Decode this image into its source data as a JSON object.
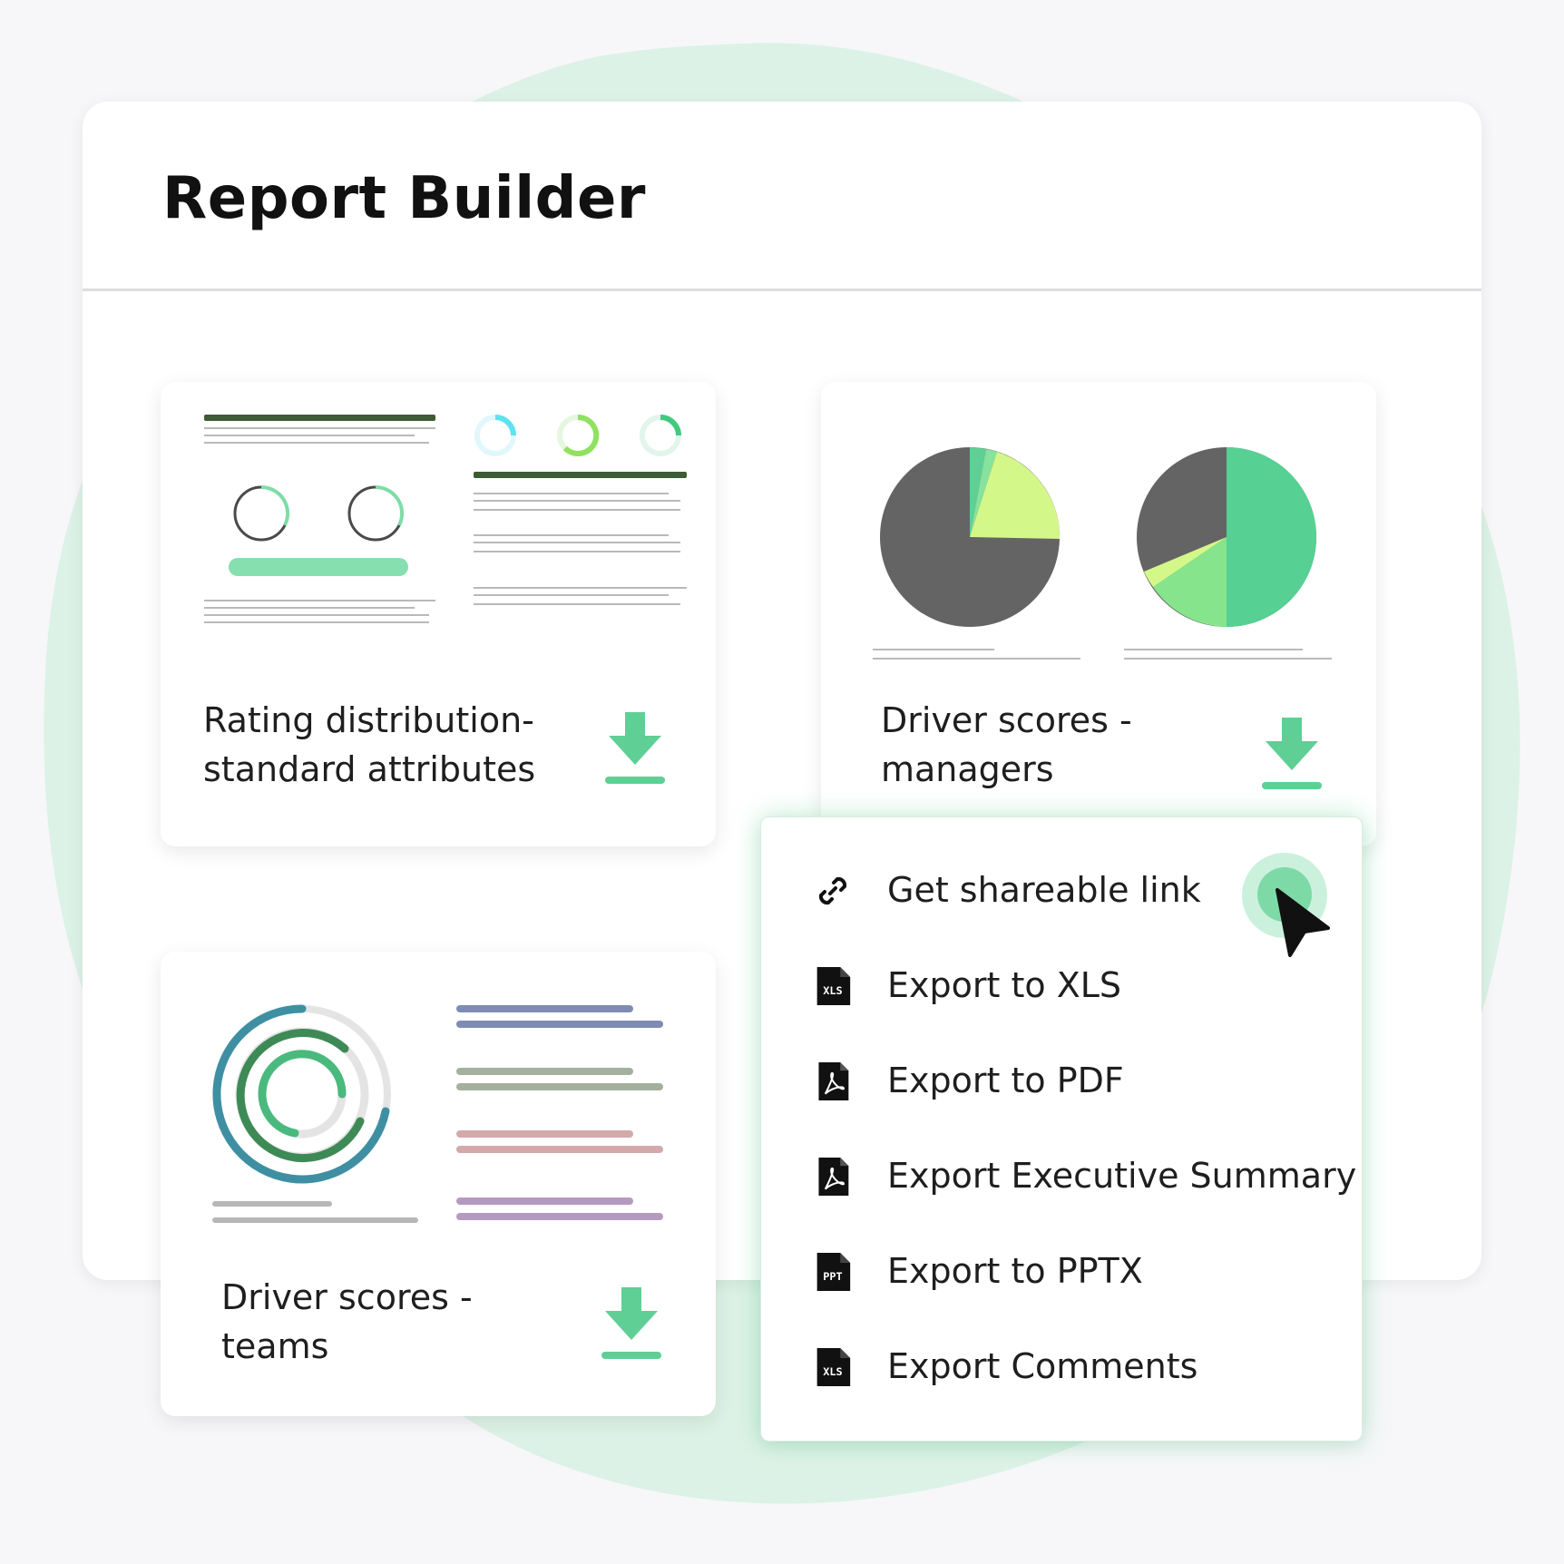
{
  "panel": {
    "title": "Report Builder"
  },
  "cards": [
    {
      "title": "Rating distribution-\nstandard attributes",
      "action_icon": "download-icon"
    },
    {
      "title": "Driver scores -\nmanagers",
      "action_icon": "download-icon"
    },
    {
      "title": "Driver scores -\nteams",
      "action_icon": "download-icon"
    }
  ],
  "export_menu": {
    "items": [
      {
        "label": "Get shareable link",
        "icon": "link-icon"
      },
      {
        "label": "Export to XLS",
        "icon": "xls-file-icon"
      },
      {
        "label": "Export to PDF",
        "icon": "pdf-file-icon"
      },
      {
        "label": "Export Executive Summary",
        "icon": "pdf-file-icon"
      },
      {
        "label": "Export to PPTX",
        "icon": "pptx-file-icon"
      },
      {
        "label": "Export Comments",
        "icon": "xls-file-icon"
      }
    ]
  },
  "icon_text": {
    "xls": "XLS",
    "ppt": "PPT"
  },
  "colors": {
    "accent_green": "#5fcf95",
    "dark_slice": "#646464",
    "lime": "#d4f78a",
    "background": "#f7f7f9",
    "blob": "#ddf2e6"
  }
}
